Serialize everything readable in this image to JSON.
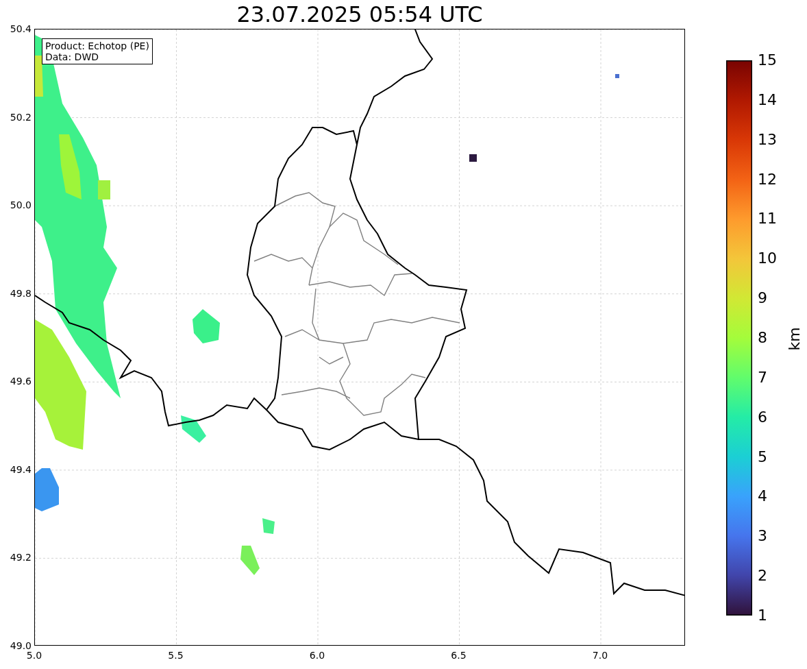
{
  "title": "23.07.2025 05:54 UTC",
  "map": {
    "legend": [
      "Product: Echotop (PE)",
      "Data: DWD"
    ],
    "x_ticks": [
      "5.0",
      "5.5",
      "6.0",
      "6.5",
      "7.0"
    ],
    "y_ticks": [
      "50.4",
      "50.2",
      "50.0",
      "49.8",
      "49.6",
      "49.4",
      "49.2",
      "49.0"
    ]
  },
  "colorbar": {
    "label": "km",
    "ticks": [
      "15",
      "14",
      "13",
      "12",
      "11",
      "10",
      "9",
      "8",
      "7",
      "6",
      "5",
      "4",
      "3",
      "2",
      "1"
    ]
  }
}
